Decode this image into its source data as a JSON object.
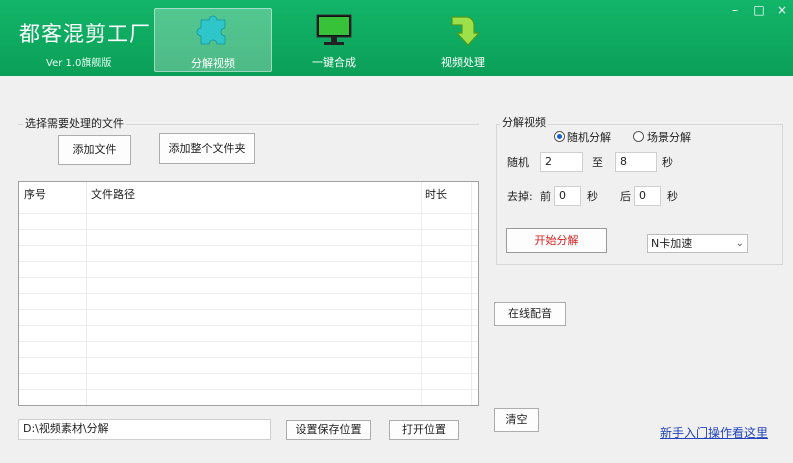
{
  "app": {
    "title": "都客混剪工厂",
    "version": "Ver 1.0旗舰版"
  },
  "nav": {
    "tabs": [
      {
        "label": "分解视频",
        "icon": "puzzle-icon",
        "active": true
      },
      {
        "label": "一键合成",
        "icon": "monitor-icon",
        "active": false
      },
      {
        "label": "视频处理",
        "icon": "green-arrow-icon",
        "active": false
      }
    ]
  },
  "window": {
    "minimize": "–",
    "maximize": "□",
    "close": "×"
  },
  "file_panel": {
    "group_label": "选择需要处理的文件",
    "add_file": "添加文件",
    "add_folder": "添加整个文件夹",
    "columns": [
      "序号",
      "文件路径",
      "时长"
    ],
    "rows": [],
    "save_path": "D:\\视频素材\\分解",
    "set_save": "设置保存位置",
    "open_location": "打开位置"
  },
  "split_panel": {
    "group_label": "分解视频",
    "mode_random": "随机分解",
    "mode_scene": "场景分解",
    "selected_mode": "随机分解",
    "random_label": "随机",
    "random_from": "2",
    "to_label": "至",
    "random_to": "8",
    "seconds_label": "秒",
    "trim_label": "去掉:",
    "front_label": "前",
    "front_value": "0",
    "back_label": "后",
    "back_value": "0",
    "start_button": "开始分解",
    "accel_option": "N卡加速"
  },
  "actions": {
    "online_dub": "在线配音",
    "clear": "清空"
  },
  "help_link": "新手入门操作看这里",
  "colors": {
    "header": "#0fa862",
    "link": "#2244bb",
    "start_text": "#d42020"
  }
}
